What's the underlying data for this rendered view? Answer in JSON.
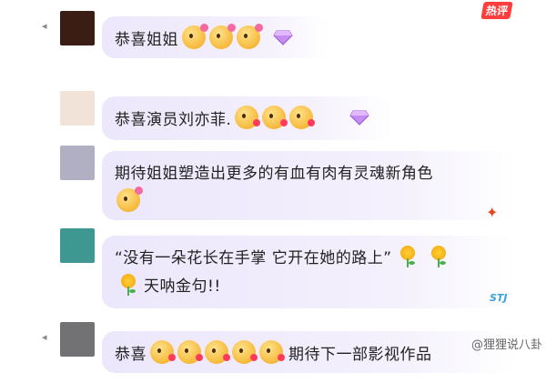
{
  "header": {
    "hot_label": "热评"
  },
  "comments": [
    {
      "avatar_color": "#3a1d14",
      "text": "恭喜姐姐",
      "emojis": 3
    },
    {
      "avatar_color": "#f2e3d8",
      "text": "恭喜演员刘亦菲.",
      "emojis": 3
    },
    {
      "avatar_color": "#b1afc2",
      "text": "期待姐姐塑造出更多的有血有肉有灵魂新角色"
    },
    {
      "avatar_color": "#3f9791",
      "text": "“没有一朵花长在手掌 它开在她的路上”",
      "text2": "天呐金句!!",
      "badge": "STJ"
    },
    {
      "avatar_color": "#727274",
      "text": "恭喜",
      "text_after": "期待下一部影视作品"
    }
  ],
  "watermark": "@狸狸说八卦",
  "colors": {
    "bubble": "#ece7fb",
    "hot_tag": "#ff3d3d"
  }
}
